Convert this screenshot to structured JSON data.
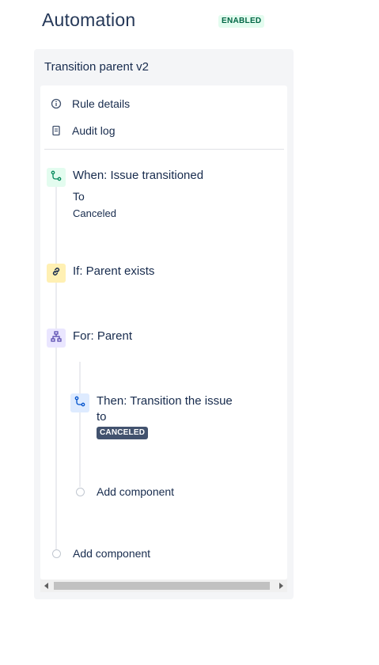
{
  "header": {
    "title": "Automation",
    "status": "ENABLED"
  },
  "rule": {
    "name": "Transition parent v2",
    "nav": [
      {
        "label": "Rule details",
        "icon": "info-icon"
      },
      {
        "label": "Audit log",
        "icon": "document-icon"
      }
    ],
    "steps": {
      "trigger": {
        "title": "When: Issue transitioned",
        "field": "To",
        "value": "Canceled",
        "color": "#e3fcef",
        "icon": "transition-icon"
      },
      "condition": {
        "title": "If: Parent exists",
        "color": "#fff0b3",
        "icon": "link-icon"
      },
      "branch": {
        "title": "For: Parent",
        "color": "#eae6ff",
        "icon": "hierarchy-icon",
        "action": {
          "title_line1": "Then: Transition the issue",
          "title_line2": "to",
          "status": "CANCELED",
          "color": "#deebff",
          "icon": "transition-icon"
        },
        "add_label": "Add component"
      },
      "add_label": "Add component"
    }
  }
}
